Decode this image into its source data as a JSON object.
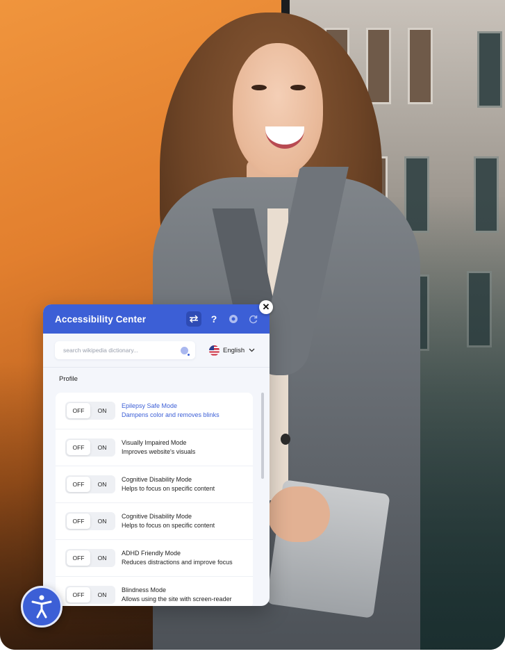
{
  "colors": {
    "accent": "#3c5fd6",
    "panel_bg": "#f4f6fb"
  },
  "panel": {
    "title": "Accessibility Center",
    "header_icons": [
      "swap-arrows-icon",
      "help-icon",
      "eye-icon",
      "refresh-icon"
    ],
    "help_glyph": "?",
    "close_icon": "close-icon"
  },
  "search": {
    "placeholder": "search wikipedia dictionary...",
    "value": ""
  },
  "language": {
    "selected": "English",
    "flag_icon": "us-flag-icon"
  },
  "profile": {
    "label": "Profile",
    "modes": [
      {
        "off": "OFF",
        "on": "ON",
        "title": "Epilepsy Safe Mode",
        "desc": "Dampens color and removes blinks",
        "highlighted": true
      },
      {
        "off": "OFF",
        "on": "ON",
        "title": "Visually Impaired Mode",
        "desc": "Improves website's visuals"
      },
      {
        "off": "OFF",
        "on": "ON",
        "title": "Cognitive Disability Mode",
        "desc": "Helps to focus on specific content"
      },
      {
        "off": "OFF",
        "on": "ON",
        "title": "Cognitive Disability Mode",
        "desc": "Helps to focus on specific content"
      },
      {
        "off": "OFF",
        "on": "ON",
        "title": "ADHD Friendly Mode",
        "desc": "Reduces distractions and improve focus"
      },
      {
        "off": "OFF",
        "on": "ON",
        "title": "Blindness Mode",
        "desc": "Allows using the site with screen-reader"
      }
    ]
  },
  "fab": {
    "icon": "accessibility-person-icon"
  }
}
